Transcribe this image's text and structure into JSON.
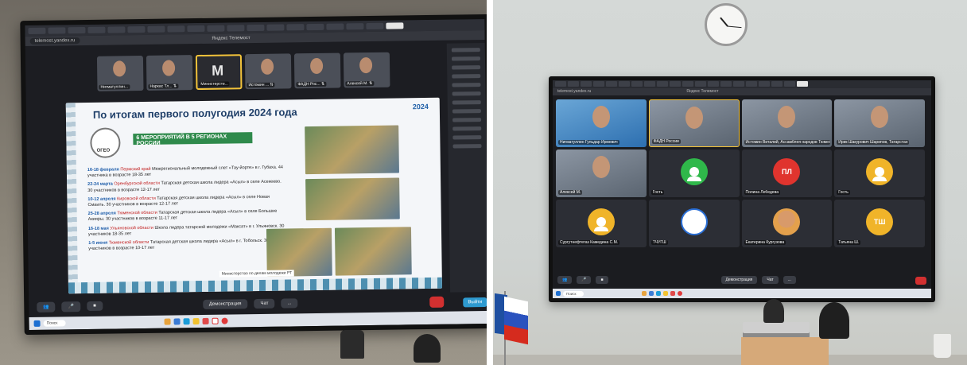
{
  "left_photo": {
    "browser": {
      "address": "telemost.yandex.ru",
      "app_title": "Яндекс Телемост"
    },
    "participants": [
      "Нигматуллин...",
      "Наркас Тл... ⇅",
      "Министерств...",
      "Истомин ... ⇅",
      "ФАДН Рос... ⇅",
      "Алексей М. ⇅"
    ],
    "slide": {
      "title": "По итогам первого полугодия 2024 года",
      "logo_text": "2024",
      "badge_text": "6 МЕРОПРИЯТИЙ В 5 РЕГИОНАХ РОССИИ",
      "ogeo_label": "ОГЕО",
      "events": [
        {
          "date": "16-18 февраля",
          "region": "Пермский край",
          "text": "Межрегиональный молодежный слет «Тау-йорте» в г. Губаха. 44 участника в возрасте 18-35 лет"
        },
        {
          "date": "22-24 марта",
          "region": "Оренбургской области",
          "text": "Татарская детская школа лидера «Асыл» в селе Асекеево. 30 участников в возрасте 12-17 лет"
        },
        {
          "date": "10-12 апреля",
          "region": "Кировской области",
          "text": "Татарская детская школа лидера «Асыл» в селе Новая Смаиль. 30 участников в возрасте 12-17 лет"
        },
        {
          "date": "25-28 апреля",
          "region": "Тюменской области",
          "text": "Татарская детская школа лидера «Асыл» в селе Большие Акияры. 30 участников в возрасте 11-17 лет"
        },
        {
          "date": "16-18 мая",
          "region": "Ульяновской области",
          "text": "Школа лидера татарской молодежи «Максат» в г. Ульяновск. 30 участников 18-35 лет"
        },
        {
          "date": "1-5 июня",
          "region": "Тюменской области",
          "text": "Татарская детская школа лидера «Асыл» в г. Тобольск. 30 участников в возрасте 10-17 лет"
        }
      ],
      "caption": "Министерство по делам молодежи РТ"
    },
    "toolbar": {
      "demo_label": "Демонстрация",
      "chat_label": "Чат",
      "more_label": "...",
      "exit_label": "Выйти"
    },
    "taskbar": {
      "search_placeholder": "Поиск"
    }
  },
  "right_photo": {
    "browser": {
      "address": "telemost.yandex.ru",
      "app_title": "Яндекс Телемост"
    },
    "tiles": [
      {
        "name": "Нигматуллин Гульдар Ирмевич",
        "kind": "video-blue"
      },
      {
        "name": "ФАДН России",
        "kind": "video-hl"
      },
      {
        "name": "Истомин Виталий, Ассамблея народов Тюмени",
        "kind": "video"
      },
      {
        "name": "Ирик Шакурович Шарипов, Татарстан",
        "kind": "video"
      },
      {
        "name": "Алексей М.",
        "kind": "video"
      },
      {
        "name": "Гость",
        "kind": "avatar",
        "color": "#2fb84a",
        "initials": ""
      },
      {
        "name": "Полина Лебедева",
        "kind": "avatar",
        "color": "#e0342e",
        "initials": "ПЛ"
      },
      {
        "name": "Гость",
        "kind": "avatar",
        "color": "#f0b429",
        "initials": ""
      },
      {
        "name": "Сургутнефтегаз Камедина С.М.",
        "kind": "avatar",
        "color": "#f0b429",
        "initials": ""
      },
      {
        "name": "ТЧУГШ",
        "kind": "logo",
        "color": "#ffffff",
        "initials": ""
      },
      {
        "name": "Екатерина Кургузова",
        "kind": "photo",
        "color": "#ffffff",
        "initials": ""
      },
      {
        "name": "Татьяна Ш.",
        "kind": "avatar",
        "color": "#f0b429",
        "initials": "ТШ"
      }
    ],
    "toolbar": {
      "demo_label": "Демонстрация",
      "chat_label": "Чат",
      "more_label": "..."
    },
    "taskbar": {
      "search_placeholder": "Поиск"
    }
  }
}
